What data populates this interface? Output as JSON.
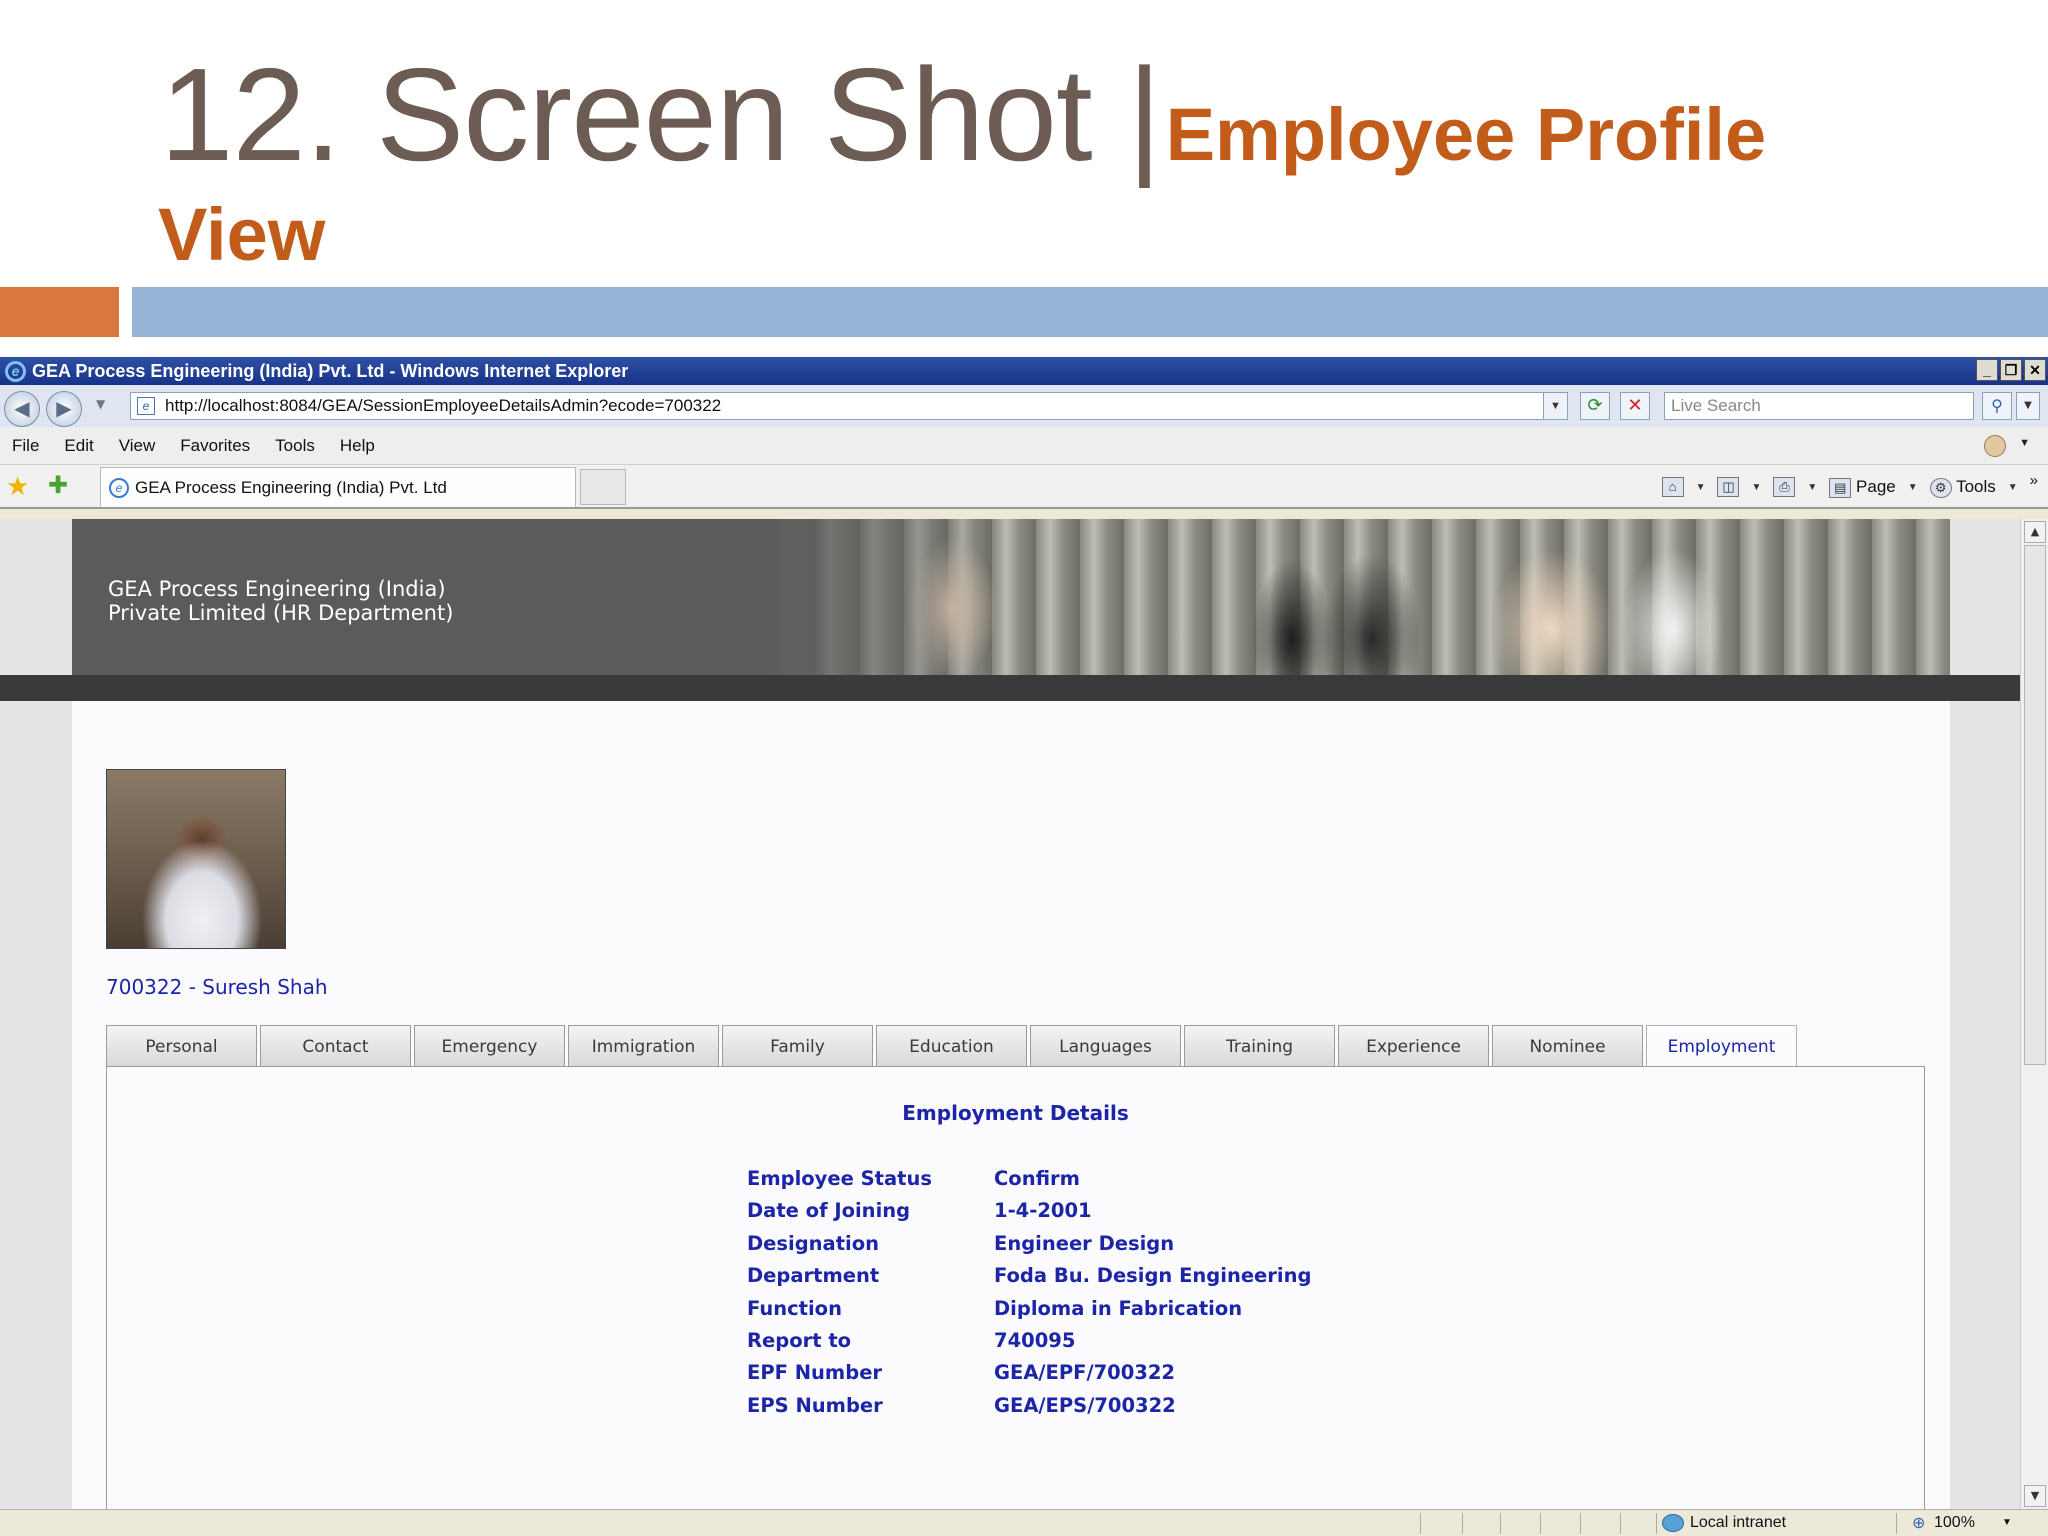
{
  "slide": {
    "title_main": "12. Screen Shot |",
    "title_sub": "Employee Profile",
    "title_sub_cont": "View",
    "accent_colors": {
      "orange": "#d9773e",
      "blue": "#93b4d4",
      "title_gray": "#6d5c54",
      "subtitle_orange": "#c25c1b"
    }
  },
  "browser": {
    "window_title": "GEA Process Engineering (India) Pvt. Ltd - Windows Internet Explorer",
    "window_buttons": [
      "_",
      "❐",
      "✕"
    ],
    "url": "http://localhost:8084/GEA/SessionEmployeeDetailsAdmin?ecode=700322",
    "search_placeholder": "Live Search",
    "menu": [
      "File",
      "Edit",
      "View",
      "Favorites",
      "Tools",
      "Help"
    ],
    "tab_title": "GEA Process Engineering (India) Pvt. Ltd",
    "command_bar": {
      "page_label": "Page",
      "tools_label": "Tools"
    },
    "status": {
      "zone": "Local intranet",
      "zoom": "100%"
    }
  },
  "site": {
    "banner_line1": "GEA Process Engineering (India)",
    "banner_line2": "Private Limited (HR Department)",
    "employee_name": "700322 - Suresh Shah",
    "text_color": "#1c25a8",
    "tabs": [
      "Personal",
      "Contact",
      "Emergency",
      "Immigration",
      "Family",
      "Education",
      "Languages",
      "Training",
      "Experience",
      "Nominee",
      "Employment"
    ],
    "active_tab": "Employment",
    "panel_title": "Employment Details",
    "details": [
      {
        "label": "Employee Status",
        "value": "Confirm"
      },
      {
        "label": "Date of Joining",
        "value": "1-4-2001"
      },
      {
        "label": "Designation",
        "value": "Engineer Design"
      },
      {
        "label": "Department",
        "value": "Foda Bu. Design Engineering"
      },
      {
        "label": "Function",
        "value": "Diploma in Fabrication"
      },
      {
        "label": "Report to",
        "value": "740095"
      },
      {
        "label": "EPF Number",
        "value": "GEA/EPF/700322"
      },
      {
        "label": "EPS Number",
        "value": "GEA/EPS/700322"
      }
    ]
  }
}
